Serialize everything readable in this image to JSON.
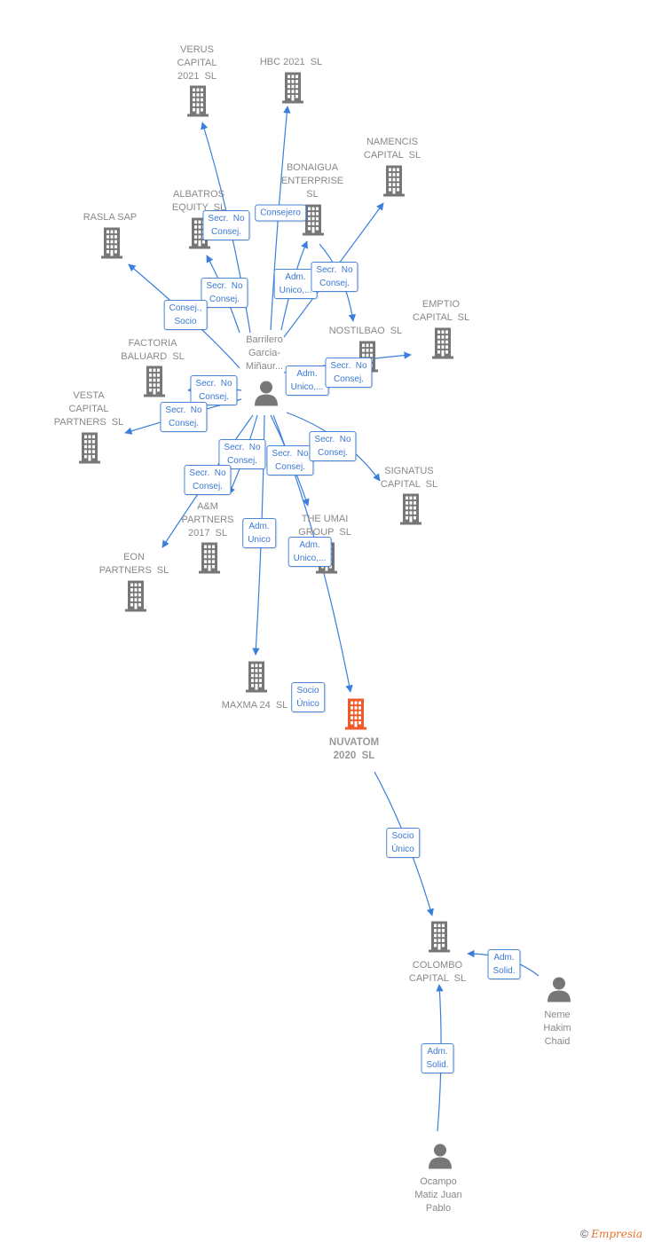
{
  "colors": {
    "edge": "#3a7fdc",
    "node": "#777777",
    "focus": "#f05a28"
  },
  "nodes": [
    {
      "label": "VERUS\nCAPITAL\n2021  SL",
      "type": "company"
    },
    {
      "label": "HBC 2021  SL",
      "type": "company"
    },
    {
      "label": "NAMENCIS\nCAPITAL  SL",
      "type": "company"
    },
    {
      "label": "BONAIGUA\nENTERPRISE\nSL",
      "type": "company"
    },
    {
      "label": "ALBATROS\nEQUITY  SL",
      "type": "company"
    },
    {
      "label": "RASLA SAP",
      "type": "company"
    },
    {
      "label": "EMPTIO\nCAPITAL  SL",
      "type": "company"
    },
    {
      "label": "NOSTILBAO  SL",
      "type": "company"
    },
    {
      "label": "FACTORIA\nBALUARD  SL",
      "type": "company"
    },
    {
      "label": "Barrilero\nGarcia-\nMiñaur...",
      "type": "person"
    },
    {
      "label": "VESTA\nCAPITAL\nPARTNERS  SL",
      "type": "company"
    },
    {
      "label": "SIGNATUS\nCAPITAL  SL",
      "type": "company"
    },
    {
      "label": "A&M\nPARTNERS\n2017  SL",
      "type": "company"
    },
    {
      "label": "THE UMAI\nGROUP  SL",
      "type": "company"
    },
    {
      "label": "EON\nPARTNERS  SL",
      "type": "company"
    },
    {
      "label": "MAXMA 24  SL",
      "type": "company"
    },
    {
      "label": "NUVATOM\n2020  SL",
      "type": "focus-company"
    },
    {
      "label": "COLOMBO\nCAPITAL  SL",
      "type": "company"
    },
    {
      "label": "Neme\nHakim\nChaid",
      "type": "person"
    },
    {
      "label": "Ocampo\nMatiz Juan\nPablo",
      "type": "person"
    }
  ],
  "edge_labels": [
    "Secr.  No\nConsej.",
    "Consejero",
    "Secr.  No\nConsej.",
    "Consej.,\nSocio",
    "Adm.\nUnico,...",
    "Secr.  No\nConsej.",
    "Adm.\nUnico,...",
    "Secr.  No\nConsej.",
    "Secr.  No\nConsej.",
    "Secr.  No\nConsej.",
    "Secr.  No\nConsej.",
    "Secr.  No\nConsej.",
    "Secr.  No\nConsej.",
    "Secr.  No\nConsej.",
    "Adm.\nUnico",
    "Adm.\nUnico,...",
    "Socio\nÚnico",
    "Socio\nÚnico",
    "Adm.\nSolid.",
    "Adm.\nSolid."
  ],
  "footer": {
    "copyright": "©",
    "brand": "Empresia"
  }
}
